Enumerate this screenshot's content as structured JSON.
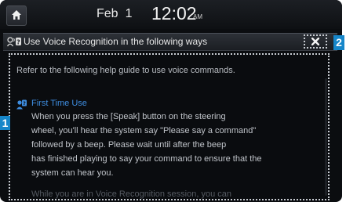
{
  "status_bar": {
    "date_month": "Feb",
    "date_day": "1",
    "time": "12:02",
    "ampm": "AM"
  },
  "title_bar": {
    "title": "Use Voice Recognition in the following ways"
  },
  "help": {
    "intro": "Refer to the following help guide to use voice commands.",
    "section_title": "First Time Use",
    "section_body": [
      "When you press the [Speak] button on the steering",
      "wheel, you'll hear the system say \"Please say a command\"",
      "followed by a beep. Please wait until after the beep",
      "has finished playing to say your command to ensure that the",
      "system can hear you."
    ],
    "faded_line": "While you are in Voice Recognition session, you can"
  },
  "callouts": [
    "1",
    "2"
  ],
  "icons": {
    "home": "home-icon",
    "voice": "voice-help-icon",
    "close": "close-icon",
    "section": "help-question-icon"
  },
  "colors": {
    "accent_blue": "#3e8de0",
    "callout_blue": "#1686c9",
    "background": "#0b0d10"
  }
}
